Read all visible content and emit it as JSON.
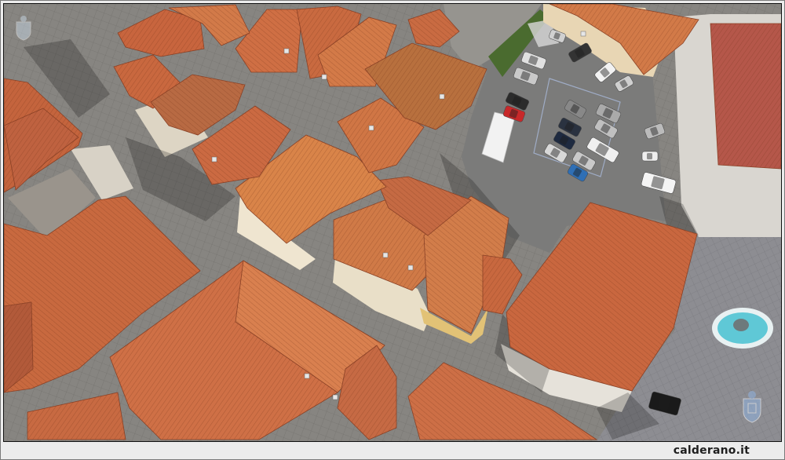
{
  "caption": "calderano.it",
  "colors": {
    "frame": "#ececec",
    "pavement": "#8a8884",
    "parking_asphalt": "#7b7b7a",
    "roof_terracotta": "#c8693f",
    "roof_dark_red": "#b5574a",
    "fountain_water": "#5fc8d6"
  },
  "icons": {
    "watermark": "coat-of-arms-watermark-icon"
  }
}
